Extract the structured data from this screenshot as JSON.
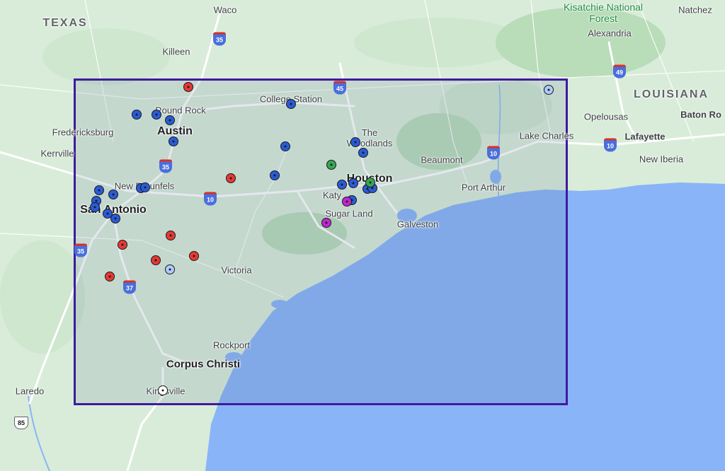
{
  "map": {
    "colors": {
      "land": "#d9ecd9",
      "water": "#8ab4f8",
      "selection_border": "#3f1a9e",
      "marker_blue": "#2a5bd7",
      "marker_red": "#e53935",
      "marker_green": "#34a853",
      "marker_magenta": "#c026d3",
      "marker_light_blue": "#aecbfa",
      "marker_white": "#ffffff"
    },
    "labels": {
      "texas": "TEXAS",
      "louisiana": "LOUISIANA",
      "kisatchie": "Kisatchie National Forest",
      "waco": "Waco",
      "killeen": "Killeen",
      "round_rock": "Round Rock",
      "austin": "Austin",
      "fredericksburg": "Fredericksburg",
      "kerrville": "Kerrville",
      "new_braunfels": "New Braunfels",
      "san_antonio": "San Antonio",
      "college_station": "College Station",
      "the_woodlands": "The Woodlands",
      "houston": "Houston",
      "katy": "Katy",
      "sugar_land": "Sugar Land",
      "beaumont": "Beaumont",
      "port_arthur": "Port Arthur",
      "galveston": "Galveston",
      "lake_charles": "Lake Charles",
      "lafayette": "Lafayette",
      "new_iberia": "New Iberia",
      "opelousas": "Opelousas",
      "baton_rouge": "Baton Ro",
      "alexandria": "Alexandria",
      "natchez": "Natchez",
      "victoria": "Victoria",
      "rockport": "Rockport",
      "corpus_christi": "Corpus Christi",
      "kingsville": "Kingsville",
      "laredo": "Laredo"
    },
    "shields": {
      "i35_north": "35",
      "i35_austin": "35",
      "i35_south": "35",
      "i45": "45",
      "i10_west": "10",
      "i10_beaumont": "10",
      "i10_louisiana": "10",
      "i37": "37",
      "i49": "49",
      "us85": "85"
    }
  }
}
